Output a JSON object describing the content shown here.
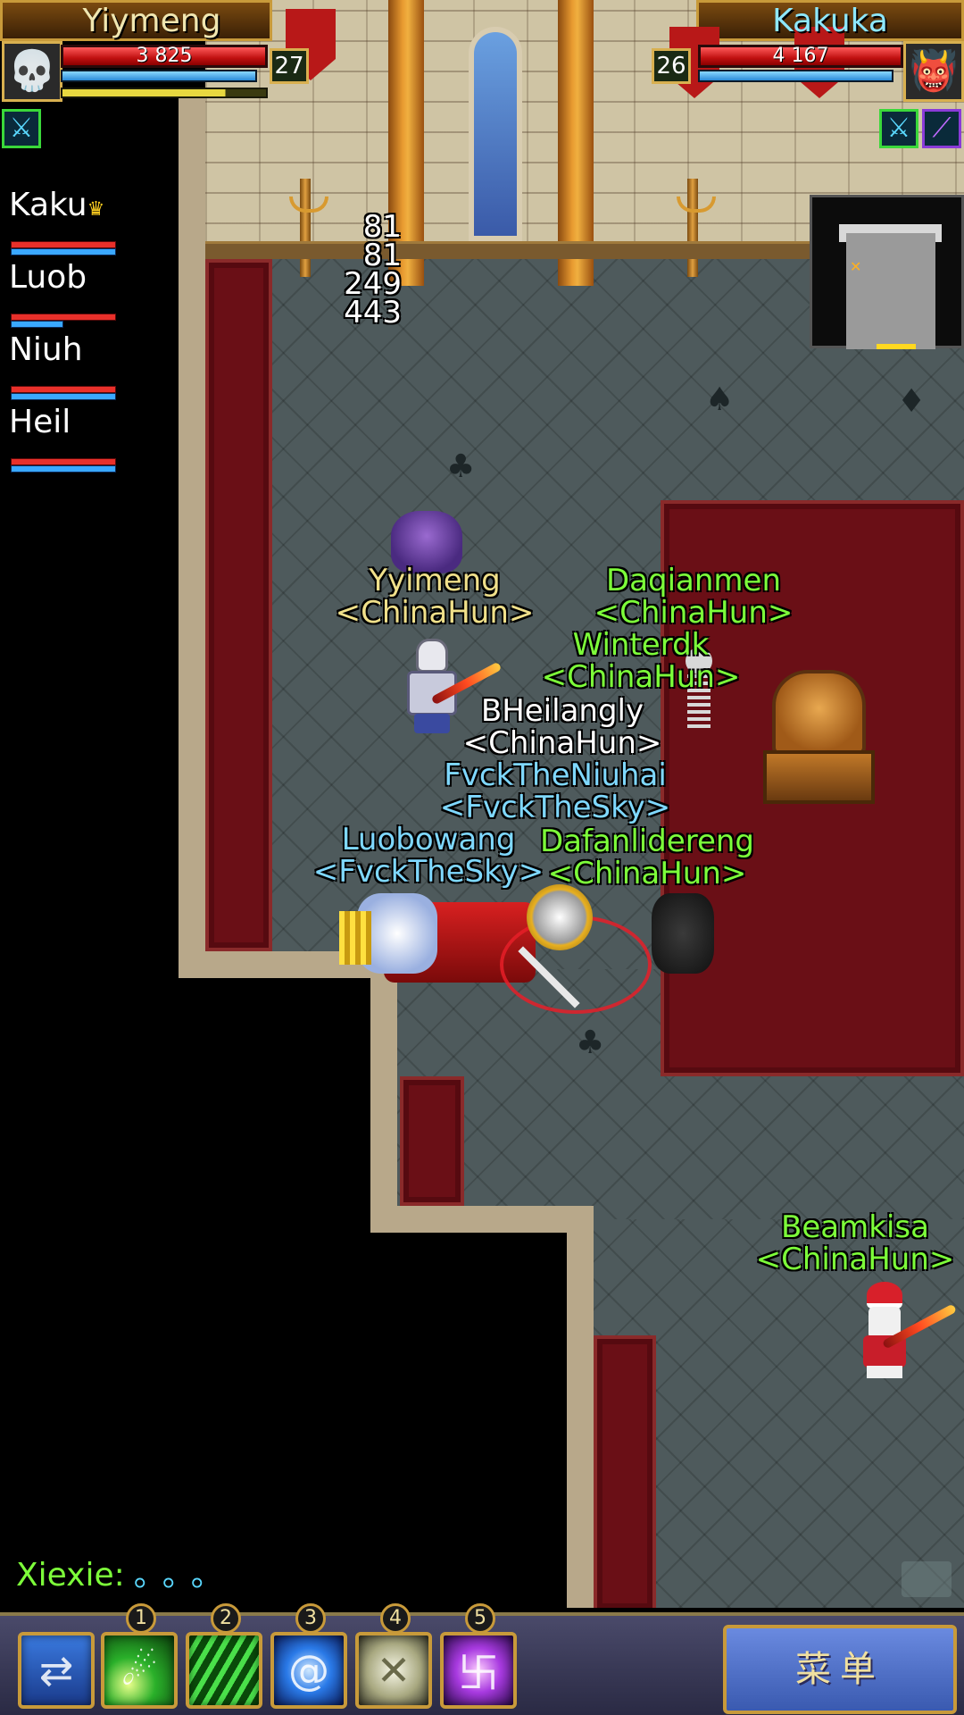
{
  "player": {
    "name": "Yiymeng",
    "hp": "3 825",
    "level": "27",
    "mp_fraction": 0.95,
    "xp_fraction": 0.8
  },
  "target": {
    "name": "Kakuka",
    "hp": "4 167",
    "level": "26",
    "mp_fraction": 0.95
  },
  "party": [
    {
      "name": "Kaku",
      "leader": true,
      "hp_fraction": 1.0,
      "mp_fraction": 1.0
    },
    {
      "name": "Luob",
      "leader": false,
      "hp_fraction": 1.0,
      "mp_fraction": 0.5
    },
    {
      "name": "Niuh",
      "leader": false,
      "hp_fraction": 1.0,
      "mp_fraction": 1.0
    },
    {
      "name": "Heil",
      "leader": false,
      "hp_fraction": 1.0,
      "mp_fraction": 1.0
    }
  ],
  "party_leader_icon": "crown-icon",
  "damage_numbers": [
    "81",
    "81",
    "249",
    "443"
  ],
  "nameplates": [
    {
      "name": "Yyimeng",
      "guild": "<ChinaHun>",
      "color": "#f0e08a"
    },
    {
      "name": "Daqianmen",
      "guild": "<ChinaHun>",
      "color": "#7dff3a"
    },
    {
      "name": "Winterdk",
      "guild": "<ChinaHun>",
      "color": "#7dff3a"
    },
    {
      "name": "BHeilangly",
      "guild": "<ChinaHun>",
      "color": "#ffffff"
    },
    {
      "name": "FvckTheNiuhai",
      "guild": "<FvckTheSky>",
      "color": "#7fd8ff"
    },
    {
      "name": "Luobowang",
      "guild": "<FvckTheSky>",
      "color": "#7fd8ff"
    },
    {
      "name": "Dafanlidereng",
      "guild": "<ChinaHun>",
      "color": "#7dff3a"
    },
    {
      "name": "Beamkisa",
      "guild": "<ChinaHun>",
      "color": "#7dff3a"
    }
  ],
  "chat": {
    "sender": "Xiexie",
    "message": "。。。"
  },
  "skills": [
    {
      "slot": "1",
      "icon": "green-comet-icon"
    },
    {
      "slot": "2",
      "icon": "green-rain-icon"
    },
    {
      "slot": "3",
      "icon": "blue-vortex-icon"
    },
    {
      "slot": "4",
      "icon": "bone-icon"
    },
    {
      "slot": "5",
      "icon": "purple-rune-icon"
    }
  ],
  "swap_icon": "swap-arrows-icon",
  "menu_label": "菜单",
  "icons": {
    "player_portrait": "skull-portrait-icon",
    "target_portrait": "demon-portrait-icon",
    "player_buff": "crossed-swords-icon",
    "target_buffs": [
      "crossed-swords-icon",
      "purple-slash-icon"
    ]
  },
  "colors": {
    "hp": "#c01010",
    "mp": "#2a8ad8",
    "xp": "#e8d840",
    "guild_ally": "#7dff3a",
    "guild_enemy": "#7fd8ff",
    "self": "#f0e08a"
  }
}
